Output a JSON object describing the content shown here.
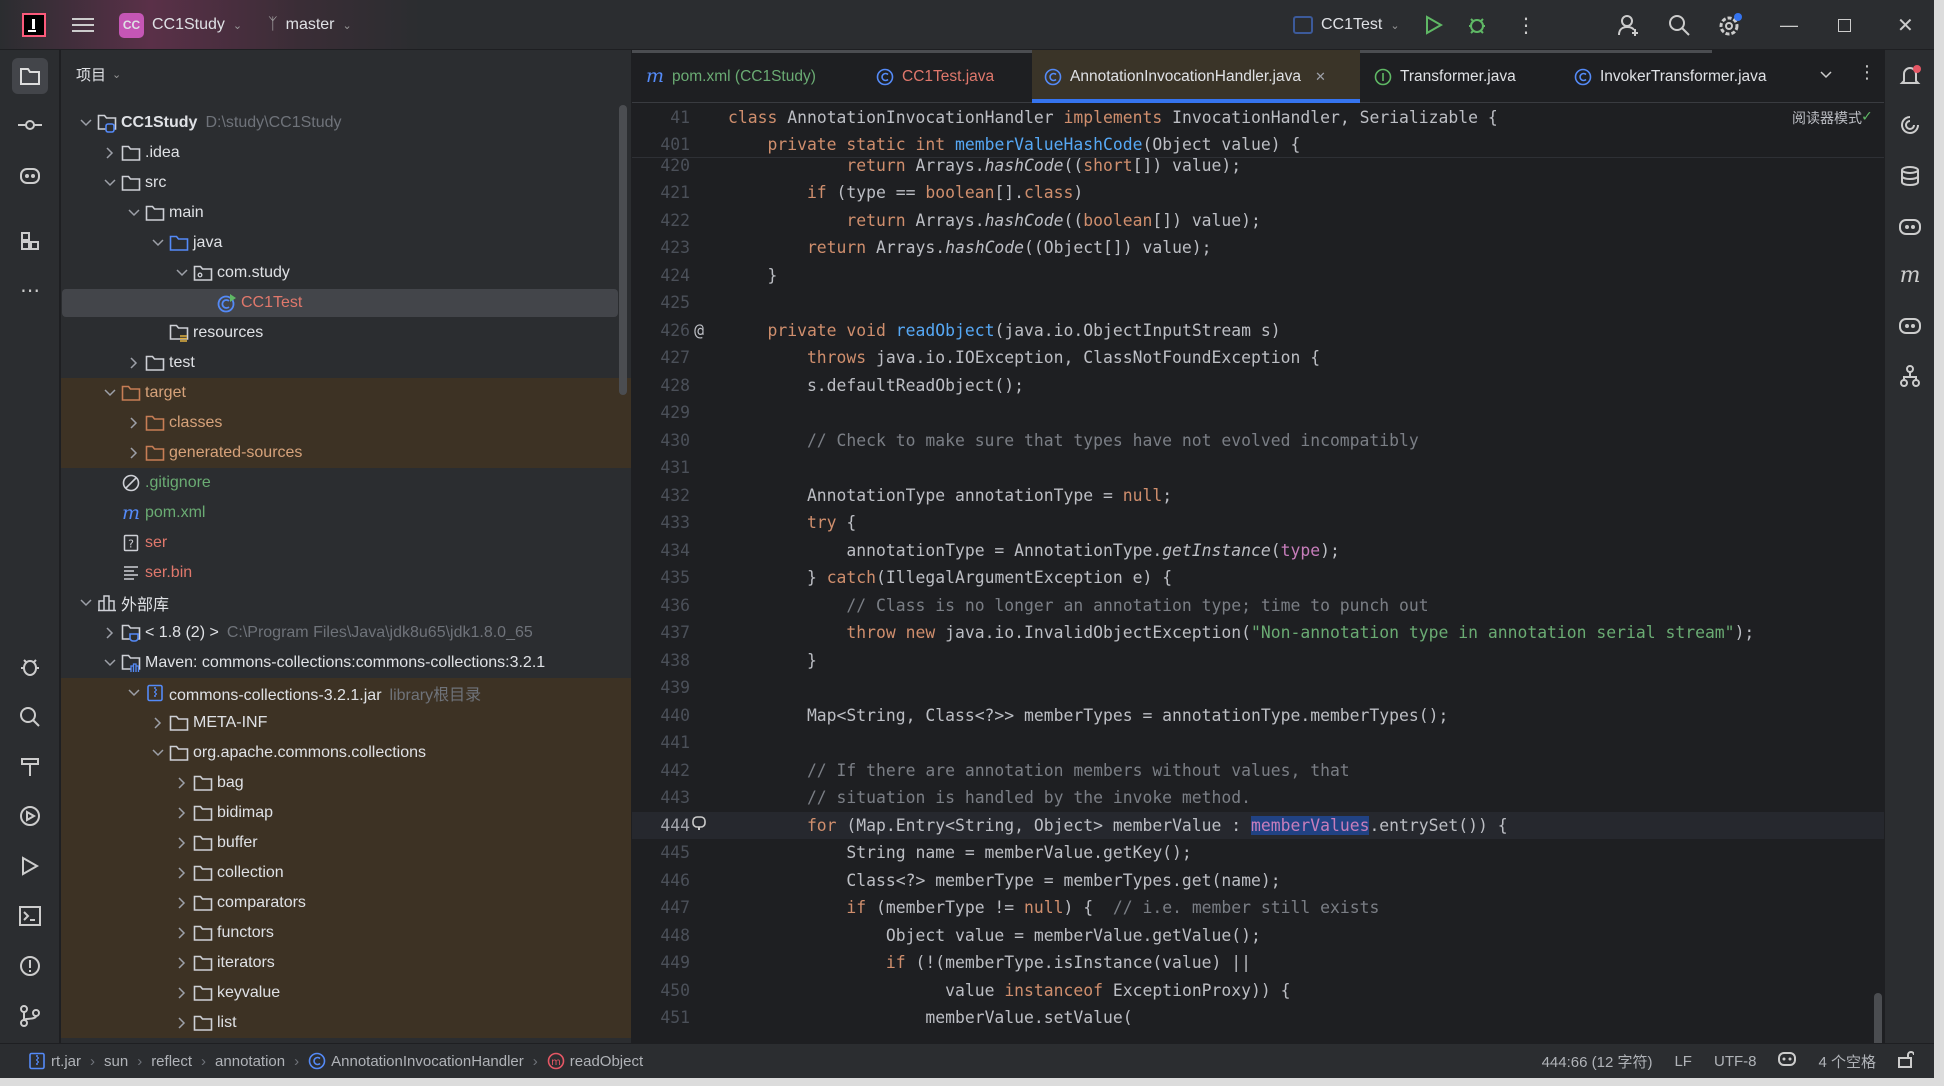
{
  "titlebar": {
    "project_badge": "CC",
    "project": "CC1Study",
    "branch": "master",
    "run_config": "CC1Test"
  },
  "panel": {
    "title": "项目"
  },
  "tree": [
    {
      "level": 0,
      "chev": "down",
      "icon": "module-folder",
      "label": "CC1Study",
      "hint": "D:\\study\\CC1Study",
      "color": "bold"
    },
    {
      "level": 1,
      "chev": "right",
      "icon": "folder",
      "label": ".idea"
    },
    {
      "level": 1,
      "chev": "down",
      "icon": "folder",
      "label": "src"
    },
    {
      "level": 2,
      "chev": "down",
      "icon": "folder",
      "label": "main"
    },
    {
      "level": 3,
      "chev": "down",
      "icon": "folder-source",
      "label": "java"
    },
    {
      "level": 4,
      "chev": "down",
      "icon": "package",
      "label": "com.study"
    },
    {
      "level": 5,
      "chev": "none",
      "icon": "class-run",
      "label": "CC1Test",
      "color": "red",
      "selected": true
    },
    {
      "level": 3,
      "chev": "none",
      "icon": "resources-folder",
      "label": "resources"
    },
    {
      "level": 2,
      "chev": "right",
      "icon": "folder",
      "label": "test"
    },
    {
      "level": 1,
      "chev": "down",
      "icon": "folder-excluded",
      "label": "target",
      "color": "orange",
      "band": true
    },
    {
      "level": 2,
      "chev": "right",
      "icon": "folder-excluded",
      "label": "classes",
      "color": "orange",
      "band": true
    },
    {
      "level": 2,
      "chev": "right",
      "icon": "folder-excluded",
      "label": "generated-sources",
      "color": "orange",
      "band": true
    },
    {
      "level": 1,
      "chev": "none",
      "icon": "ignore-file",
      "label": ".gitignore",
      "color": "green"
    },
    {
      "level": 1,
      "chev": "none",
      "icon": "maven",
      "label": "pom.xml",
      "color": "green"
    },
    {
      "level": 1,
      "chev": "none",
      "icon": "unknown-file",
      "label": "ser",
      "color": "red"
    },
    {
      "level": 1,
      "chev": "none",
      "icon": "text-file",
      "label": "ser.bin",
      "color": "red"
    },
    {
      "level": 0,
      "chev": "down",
      "icon": "library",
      "label": "外部库"
    },
    {
      "level": 1,
      "chev": "right",
      "icon": "jdk",
      "label": "< 1.8 (2) >",
      "hint": "C:\\Program Files\\Java\\jdk8u65\\jdk1.8.0_65"
    },
    {
      "level": 1,
      "chev": "down",
      "icon": "library-folder",
      "label": "Maven: commons-collections:commons-collections:3.2.1"
    },
    {
      "level": 2,
      "chev": "down",
      "icon": "jar",
      "label": "commons-collections-3.2.1.jar",
      "hint": "library根目录",
      "band": true
    },
    {
      "level": 3,
      "chev": "right",
      "icon": "folder",
      "label": "META-INF",
      "band": true
    },
    {
      "level": 3,
      "chev": "down",
      "icon": "folder",
      "label": "org.apache.commons.collections",
      "band": true
    },
    {
      "level": 4,
      "chev": "right",
      "icon": "folder",
      "label": "bag",
      "band": true
    },
    {
      "level": 4,
      "chev": "right",
      "icon": "folder",
      "label": "bidimap",
      "band": true
    },
    {
      "level": 4,
      "chev": "right",
      "icon": "folder",
      "label": "buffer",
      "band": true
    },
    {
      "level": 4,
      "chev": "right",
      "icon": "folder",
      "label": "collection",
      "band": true
    },
    {
      "level": 4,
      "chev": "right",
      "icon": "folder",
      "label": "comparators",
      "band": true
    },
    {
      "level": 4,
      "chev": "right",
      "icon": "folder",
      "label": "functors",
      "band": true
    },
    {
      "level": 4,
      "chev": "right",
      "icon": "folder",
      "label": "iterators",
      "band": true
    },
    {
      "level": 4,
      "chev": "right",
      "icon": "folder",
      "label": "keyvalue",
      "band": true
    },
    {
      "level": 4,
      "chev": "right",
      "icon": "folder",
      "label": "list",
      "band": true
    }
  ],
  "tabs": [
    {
      "label": "pom.xml (CC1Study)",
      "icon": "maven",
      "color": "#6aab73"
    },
    {
      "label": "CC1Test.java",
      "icon": "class",
      "color": "#e0786c"
    },
    {
      "label": "AnnotationInvocationHandler.java",
      "icon": "class",
      "color": "#dfe1e5",
      "active": true
    },
    {
      "label": "Transformer.java",
      "icon": "interface",
      "color": "#dfe1e5"
    },
    {
      "label": "InvokerTransformer.java",
      "icon": "class",
      "color": "#dfe1e5"
    }
  ],
  "editor": {
    "reader_mode": "阅读器模式",
    "sticky": [
      {
        "n": "41",
        "indent": 0,
        "t": [
          [
            "class ",
            "kw"
          ],
          [
            "AnnotationInvocationHandler ",
            ""
          ],
          [
            "implements ",
            "kw"
          ],
          [
            "InvocationHandler, Serializable {",
            ""
          ]
        ]
      },
      {
        "n": "401",
        "indent": 1,
        "t": [
          [
            "private static int ",
            "kw"
          ],
          [
            "memberValueHashCode",
            "fn"
          ],
          [
            "(Object value) {",
            ""
          ]
        ]
      }
    ],
    "lines": [
      {
        "n": "420",
        "indent": 3,
        "t": [
          [
            "return ",
            "kw"
          ],
          [
            "Arrays.",
            ""
          ],
          [
            "hashCode",
            "it"
          ],
          [
            "((",
            ""
          ],
          [
            "short",
            "kw"
          ],
          [
            "[]) value);",
            ""
          ]
        ]
      },
      {
        "n": "421",
        "indent": 2,
        "t": [
          [
            "if ",
            "kw"
          ],
          [
            "(type == ",
            ""
          ],
          [
            "boolean",
            "kw"
          ],
          [
            "[].",
            ""
          ],
          [
            "class",
            "kw"
          ],
          [
            ")",
            ""
          ]
        ]
      },
      {
        "n": "422",
        "indent": 3,
        "t": [
          [
            "return ",
            "kw"
          ],
          [
            "Arrays.",
            ""
          ],
          [
            "hashCode",
            "it"
          ],
          [
            "((",
            ""
          ],
          [
            "boolean",
            "kw"
          ],
          [
            "[]) value);",
            ""
          ]
        ]
      },
      {
        "n": "423",
        "indent": 2,
        "t": [
          [
            "return ",
            "kw"
          ],
          [
            "Arrays.",
            ""
          ],
          [
            "hashCode",
            "it"
          ],
          [
            "((Object[]) value);",
            ""
          ]
        ]
      },
      {
        "n": "424",
        "indent": 1,
        "t": [
          [
            "}",
            ""
          ]
        ]
      },
      {
        "n": "425",
        "indent": 0,
        "t": []
      },
      {
        "n": "426",
        "gutter": "@",
        "indent": 1,
        "t": [
          [
            "private void ",
            "kw"
          ],
          [
            "readObject",
            "fn"
          ],
          [
            "(java.io.ObjectInputStream s)",
            ""
          ]
        ]
      },
      {
        "n": "427",
        "indent": 2,
        "t": [
          [
            "throws ",
            "kw"
          ],
          [
            "java.io.IOException, ClassNotFoundException {",
            ""
          ]
        ]
      },
      {
        "n": "428",
        "indent": 2,
        "t": [
          [
            "s.defaultReadObject();",
            ""
          ]
        ]
      },
      {
        "n": "429",
        "indent": 0,
        "t": []
      },
      {
        "n": "430",
        "indent": 2,
        "t": [
          [
            "// Check to make sure that types have not evolved incompatibly",
            "cm"
          ]
        ]
      },
      {
        "n": "431",
        "indent": 0,
        "t": []
      },
      {
        "n": "432",
        "indent": 2,
        "t": [
          [
            "AnnotationType annotationType = ",
            ""
          ],
          [
            "null",
            "kw"
          ],
          [
            ";",
            ""
          ]
        ]
      },
      {
        "n": "433",
        "indent": 2,
        "t": [
          [
            "try ",
            "kw"
          ],
          [
            "{",
            ""
          ]
        ]
      },
      {
        "n": "434",
        "indent": 3,
        "t": [
          [
            "annotationType = AnnotationType.",
            ""
          ],
          [
            "getInstance",
            "it"
          ],
          [
            "(",
            ""
          ],
          [
            "type",
            "fld"
          ],
          [
            ");",
            ""
          ]
        ]
      },
      {
        "n": "435",
        "indent": 2,
        "t": [
          [
            "} ",
            ""
          ],
          [
            "catch",
            "kw"
          ],
          [
            "(IllegalArgumentException e) {",
            ""
          ]
        ]
      },
      {
        "n": "436",
        "indent": 3,
        "t": [
          [
            "// Class is no longer an annotation type; time to punch out",
            "cm"
          ]
        ]
      },
      {
        "n": "437",
        "indent": 3,
        "t": [
          [
            "throw new ",
            "kw"
          ],
          [
            "java.io.InvalidObjectException(",
            ""
          ],
          [
            "\"Non-annotation type in annotation serial stream\"",
            "st"
          ],
          [
            ");",
            ""
          ]
        ]
      },
      {
        "n": "438",
        "indent": 2,
        "t": [
          [
            "}",
            ""
          ]
        ]
      },
      {
        "n": "439",
        "indent": 0,
        "t": []
      },
      {
        "n": "440",
        "indent": 2,
        "t": [
          [
            "Map<String, Class<?>> memberTypes = annotationType.memberTypes();",
            ""
          ]
        ]
      },
      {
        "n": "441",
        "indent": 0,
        "t": []
      },
      {
        "n": "442",
        "indent": 2,
        "t": [
          [
            "// If there are annotation members without values, that",
            "cm"
          ]
        ]
      },
      {
        "n": "443",
        "indent": 2,
        "t": [
          [
            "// situation is handled by the invoke method.",
            "cm"
          ]
        ]
      },
      {
        "n": "444",
        "gutter": "ai",
        "indent": 2,
        "current": true,
        "t": [
          [
            "for ",
            "kw"
          ],
          [
            "(Map.Entry<String, Object> memberValue : ",
            ""
          ],
          [
            "memberValues",
            "fld sel"
          ],
          [
            ".entrySet()) {",
            ""
          ]
        ]
      },
      {
        "n": "445",
        "indent": 3,
        "t": [
          [
            "String name = memberValue.getKey();",
            ""
          ]
        ]
      },
      {
        "n": "446",
        "indent": 3,
        "t": [
          [
            "Class<?> memberType = memberTypes.get(name);",
            ""
          ]
        ]
      },
      {
        "n": "447",
        "indent": 3,
        "t": [
          [
            "if ",
            "kw"
          ],
          [
            "(memberType != ",
            ""
          ],
          [
            "null",
            "kw"
          ],
          [
            ") {  ",
            ""
          ],
          [
            "// i.e. member still exists",
            "cm"
          ]
        ]
      },
      {
        "n": "448",
        "indent": 4,
        "t": [
          [
            "Object value = memberValue.getValue();",
            ""
          ]
        ]
      },
      {
        "n": "449",
        "indent": 4,
        "t": [
          [
            "if ",
            "kw"
          ],
          [
            "(!(memberType.isInstance(value) ||",
            ""
          ]
        ]
      },
      {
        "n": "450",
        "indent": 5.5,
        "t": [
          [
            "value ",
            ""
          ],
          [
            "instanceof ",
            "kw"
          ],
          [
            "ExceptionProxy)) {",
            ""
          ]
        ]
      },
      {
        "n": "451",
        "indent": 5,
        "t": [
          [
            "memberValue.setValue(",
            ""
          ]
        ]
      }
    ]
  },
  "status": {
    "breadcrumbs": [
      {
        "label": "rt.jar",
        "icon": "jar"
      },
      {
        "label": "sun"
      },
      {
        "label": "reflect"
      },
      {
        "label": "annotation"
      },
      {
        "label": "AnnotationInvocationHandler",
        "icon": "class"
      },
      {
        "label": "readObject",
        "icon": "method"
      }
    ],
    "position": "444:66 (12 字符)",
    "line_ending": "LF",
    "encoding": "UTF-8",
    "indent": "4 个空格"
  },
  "colors": {
    "accent": "#3574f0",
    "keyword": "#cf8e6d",
    "method": "#56a8f5",
    "string": "#6aab73",
    "comment": "#7a7e85",
    "field": "#c77dbb"
  }
}
